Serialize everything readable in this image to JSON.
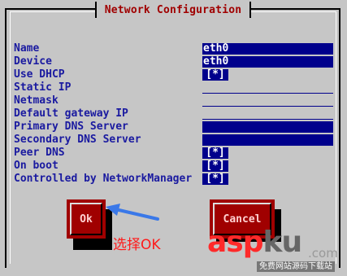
{
  "dialog": {
    "title": "Network Configuration"
  },
  "fields": [
    {
      "label": "Name",
      "kind": "text",
      "value": "eth0"
    },
    {
      "label": "Device",
      "kind": "text",
      "value": "eth0"
    },
    {
      "label": "Use DHCP",
      "kind": "checkbox",
      "value": "[*]"
    },
    {
      "label": "Static IP",
      "kind": "line",
      "value": ""
    },
    {
      "label": "Netmask",
      "kind": "line",
      "value": ""
    },
    {
      "label": "Default gateway IP",
      "kind": "line",
      "value": ""
    },
    {
      "label": "Primary DNS Server",
      "kind": "text",
      "value": ""
    },
    {
      "label": "Secondary DNS Server",
      "kind": "text",
      "value": ""
    },
    {
      "label": "Peer DNS",
      "kind": "checkbox",
      "value": "[*]"
    },
    {
      "label": "On boot",
      "kind": "checkbox",
      "value": "[*]"
    },
    {
      "label": "Controlled by NetworkManager",
      "kind": "checkbox",
      "value": "[*]"
    }
  ],
  "buttons": {
    "ok": "Ok",
    "cancel": "Cancel"
  },
  "annotation": {
    "text": "选择OK",
    "color": "#ff1a1a"
  },
  "watermark": {
    "brand_red": "asp",
    "brand_gray": "ku",
    "tld": ".com",
    "tagline": "免费网站源码下载站"
  },
  "colors": {
    "background": "#c6c6c6",
    "field": "#00008c",
    "label": "#1a1aa0",
    "title": "#a00000",
    "button": "#a00000"
  }
}
